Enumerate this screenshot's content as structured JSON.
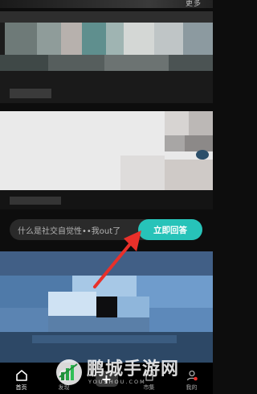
{
  "top": {
    "more_label": "更多"
  },
  "question": {
    "text": "什么是社交自觉性••我out了",
    "answer_label": "立即回答"
  },
  "nav": {
    "items": [
      {
        "label": "首页",
        "icon": "home-icon"
      },
      {
        "label": "发现",
        "icon": "discover-icon"
      },
      {
        "label": "",
        "icon": "plus-icon"
      },
      {
        "label": "市集",
        "icon": "shop-icon"
      },
      {
        "label": "我的",
        "icon": "profile-icon"
      }
    ]
  },
  "watermark": {
    "title": "鹏城手游网",
    "subtitle": "YOUSHOU.COM"
  },
  "colors": {
    "accent": "#27c3b9",
    "arrow": "#e8302a",
    "background": "#0d0d0d"
  }
}
